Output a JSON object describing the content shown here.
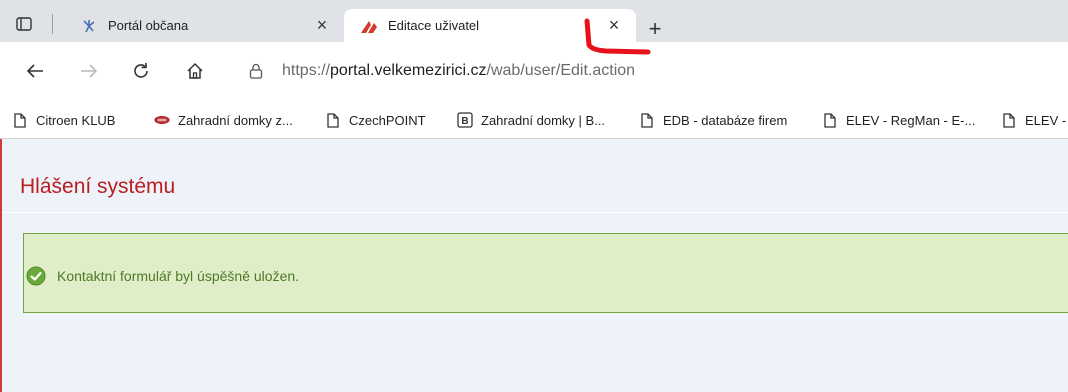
{
  "tabs": [
    {
      "title": "Portál občana",
      "close": "×"
    },
    {
      "title": "Editace uživatel",
      "close": "×"
    }
  ],
  "new_tab": "+",
  "address": {
    "scheme": "https://",
    "host": "portal.velkemezirici.cz",
    "path": "/wab/user/Edit.action"
  },
  "bookmarks": [
    {
      "label": "Citroen KLUB",
      "icon": "page-icon"
    },
    {
      "label": "Zahradní domky z...",
      "icon": "site-logo-icon"
    },
    {
      "label": "CzechPOINT",
      "icon": "page-icon"
    },
    {
      "label": "Zahradní domky | B...",
      "icon": "b-icon"
    },
    {
      "label": "EDB - databáze firem",
      "icon": "page-icon"
    },
    {
      "label": "ELEV - RegMan - E-...",
      "icon": "page-icon"
    },
    {
      "label": "ELEV -",
      "icon": "page-icon"
    }
  ],
  "page": {
    "heading": "Hlášení systému",
    "message": "Kontaktní formulář byl úspěšně uložen."
  },
  "colors": {
    "heading": "#b81f20",
    "success_bg": "#dfedc9",
    "success_border": "#6fa73b",
    "success_text": "#4d7a25",
    "annotation": "#e8121a"
  }
}
